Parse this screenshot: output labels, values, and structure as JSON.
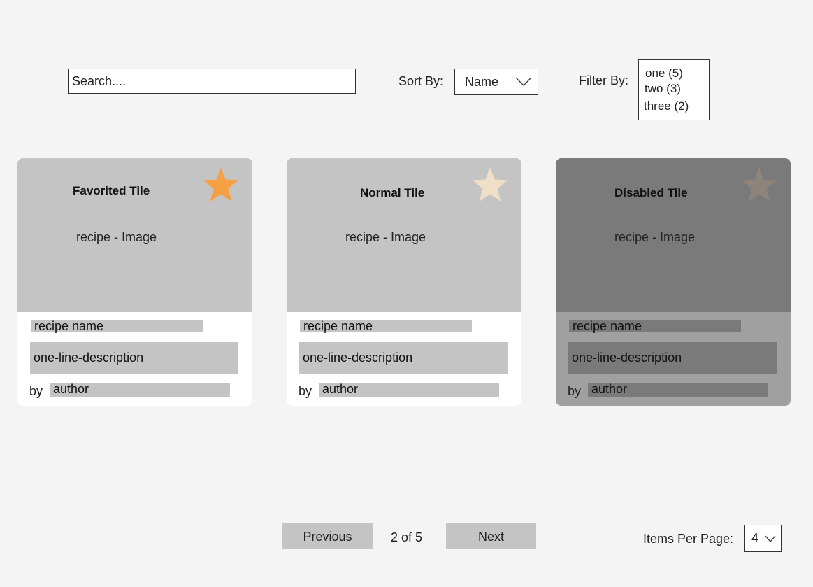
{
  "search": {
    "placeholder": "Search...."
  },
  "sort": {
    "label": "Sort By:",
    "value": "Name"
  },
  "filter": {
    "label": "Filter By:",
    "options": [
      "one (5)",
      "two (3)",
      "three (2)"
    ]
  },
  "tiles": [
    {
      "title": "Favorited Tile",
      "image_text": "recipe - Image",
      "name": "recipe name",
      "description": "one-line-description",
      "by": "by",
      "author": "author",
      "star_color": "#f5a042",
      "state": "favorited"
    },
    {
      "title": "Normal Tile",
      "image_text": "recipe - Image",
      "name": "recipe name",
      "description": "one-line-description",
      "by": "by",
      "author": "author",
      "star_color": "#efdfc9",
      "state": "normal"
    },
    {
      "title": "Disabled Tile",
      "image_text": "recipe - Image",
      "name": "recipe name",
      "description": "one-line-description",
      "by": "by",
      "author": "author",
      "star_color": "#8d847b",
      "state": "disabled"
    }
  ],
  "pagination": {
    "previous_label": "Previous",
    "indicator": "2 of 5",
    "next_label": "Next"
  },
  "items_per_page": {
    "label": "Items Per Page:",
    "value": "4"
  },
  "icons": {
    "star": "star-icon",
    "dropdown": "chevron-down-icon"
  }
}
